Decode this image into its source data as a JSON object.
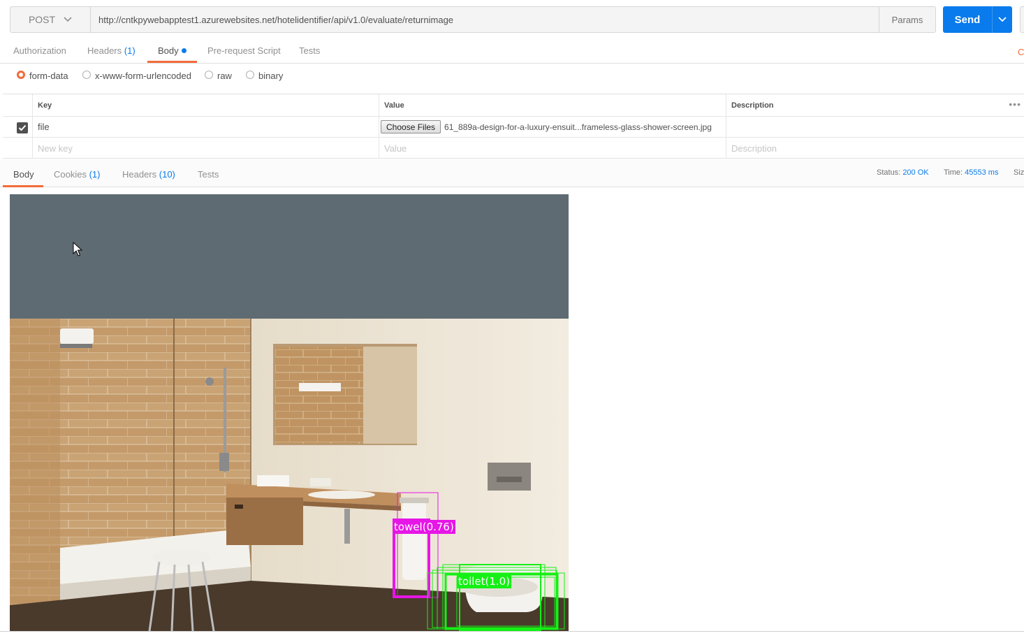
{
  "request": {
    "method": "POST",
    "url": "http://cntkpywebapptest1.azurewebsites.net/hotelidentifier/api/v1.0/evaluate/returnimage",
    "params_label": "Params",
    "send_label": "Send"
  },
  "request_tabs": {
    "authorization": "Authorization",
    "headers_label": "Headers",
    "headers_count": "(1)",
    "body": "Body",
    "prerequest": "Pre-request Script",
    "tests": "Tests",
    "cookies_edge": "Co"
  },
  "body_types": {
    "form_data": "form-data",
    "urlencoded": "x-www-form-urlencoded",
    "raw": "raw",
    "binary": "binary",
    "selected": "form-data"
  },
  "form_table": {
    "headers": {
      "key": "Key",
      "value": "Value",
      "description": "Description"
    },
    "row": {
      "key": "file",
      "checked": true,
      "choose_files": "Choose Files",
      "file_name": "61_889a-design-for-a-luxury-ensuit...frameless-glass-shower-screen.jpg"
    },
    "new_row": {
      "key": "New key",
      "value": "Value",
      "description": "Description"
    }
  },
  "response": {
    "tabs": {
      "body": "Body",
      "cookies_label": "Cookies",
      "cookies_count": "(1)",
      "headers_label": "Headers",
      "headers_count": "(10)",
      "tests": "Tests"
    },
    "status_label": "Status:",
    "status_value": "200 OK",
    "time_label": "Time:",
    "time_value": "45553 ms",
    "size_label": "Siz"
  },
  "detections": {
    "towel": "towel(0.76)",
    "toilet": "toilet(1.0)",
    "towel_color": "#e616e6",
    "toilet_color": "#14f014"
  },
  "colors": {
    "accent": "#097bed",
    "active_tab": "#f26b3a"
  }
}
